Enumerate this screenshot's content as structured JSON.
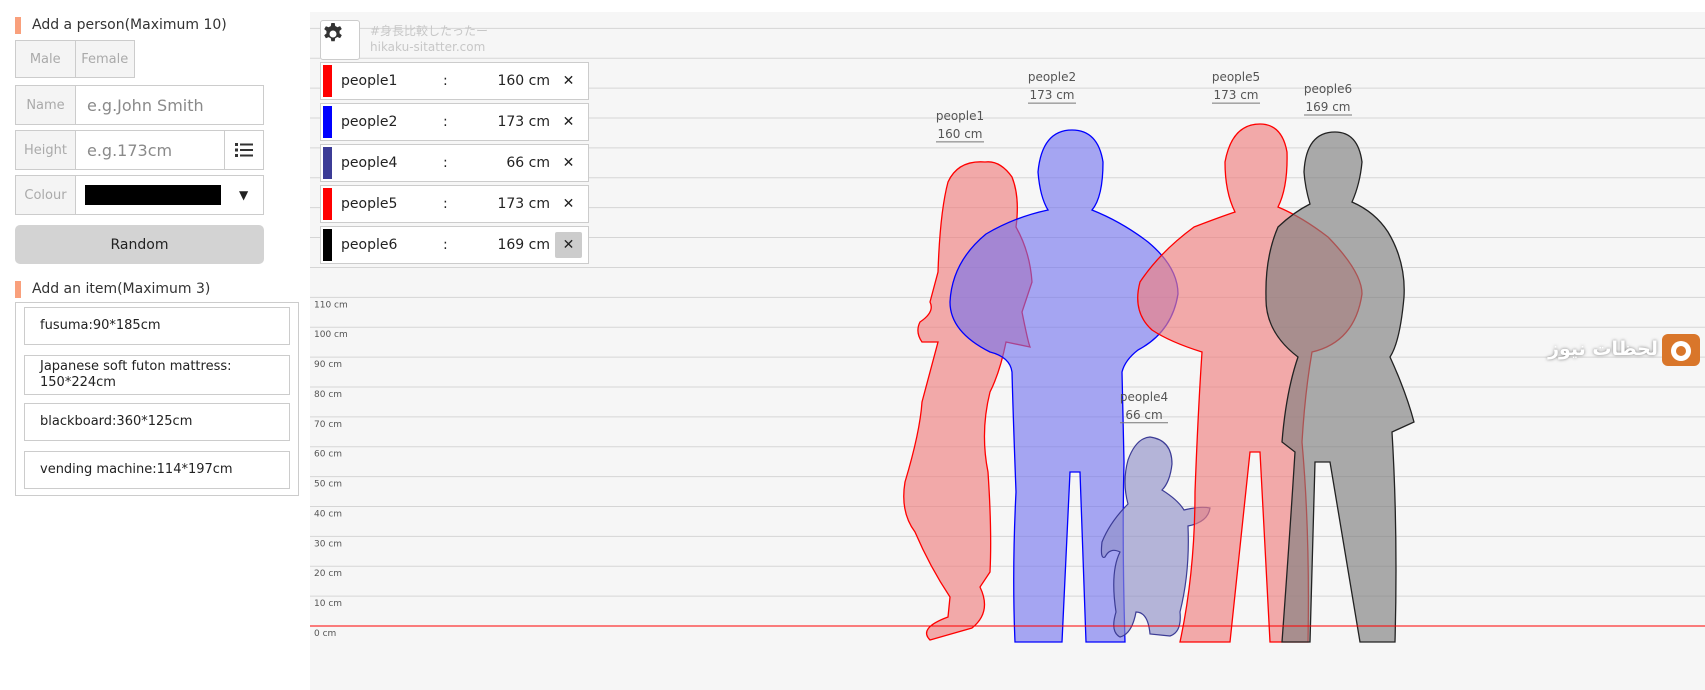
{
  "left": {
    "add_person_title": "Add a person(Maximum 10)",
    "gender_male": "Male",
    "gender_female": "Female",
    "name_label": "Name",
    "name_placeholder": "e.g.John Smith",
    "height_label": "Height",
    "height_placeholder": "e.g.173cm",
    "colour_label": "Colour",
    "colour_value": "#000000",
    "random_label": "Random",
    "add_item_title": "Add an item(Maximum 3)",
    "items": [
      "fusuma:90*185cm",
      "Japanese soft futon mattress:\n150*224cm",
      "blackboard:360*125cm",
      "vending machine:114*197cm"
    ]
  },
  "chart": {
    "watermark_line1": "#身長比較したったー",
    "watermark_line2": "hikaku-sitatter.com",
    "people": [
      {
        "name": "people1",
        "height": "160 cm",
        "value": 160,
        "color": "#ff0000",
        "swatch": "#ff0000",
        "sep": ":"
      },
      {
        "name": "people2",
        "height": "173 cm",
        "value": 173,
        "color": "#0000ff",
        "swatch": "#0000ff",
        "sep": ":"
      },
      {
        "name": "people4",
        "height": "66 cm",
        "value": 66,
        "color": "#3c3c96",
        "swatch": "#3c3c96",
        "sep": ":"
      },
      {
        "name": "people5",
        "height": "173 cm",
        "value": 173,
        "color": "#ff0000",
        "swatch": "#ff0000",
        "sep": ":"
      },
      {
        "name": "people6",
        "height": "169 cm",
        "value": 169,
        "color": "#000000",
        "swatch": "#000000",
        "sep": ":"
      }
    ],
    "close_symbol": "✕",
    "tick_labels": [
      "0 cm",
      "10 cm",
      "20 cm",
      "30 cm",
      "40 cm",
      "50 cm",
      "60 cm",
      "70 cm",
      "80 cm",
      "90 cm",
      "100 cm",
      "110 cm"
    ],
    "ground_color": "#ff0000",
    "logo_text": "لحظات نيوز"
  }
}
